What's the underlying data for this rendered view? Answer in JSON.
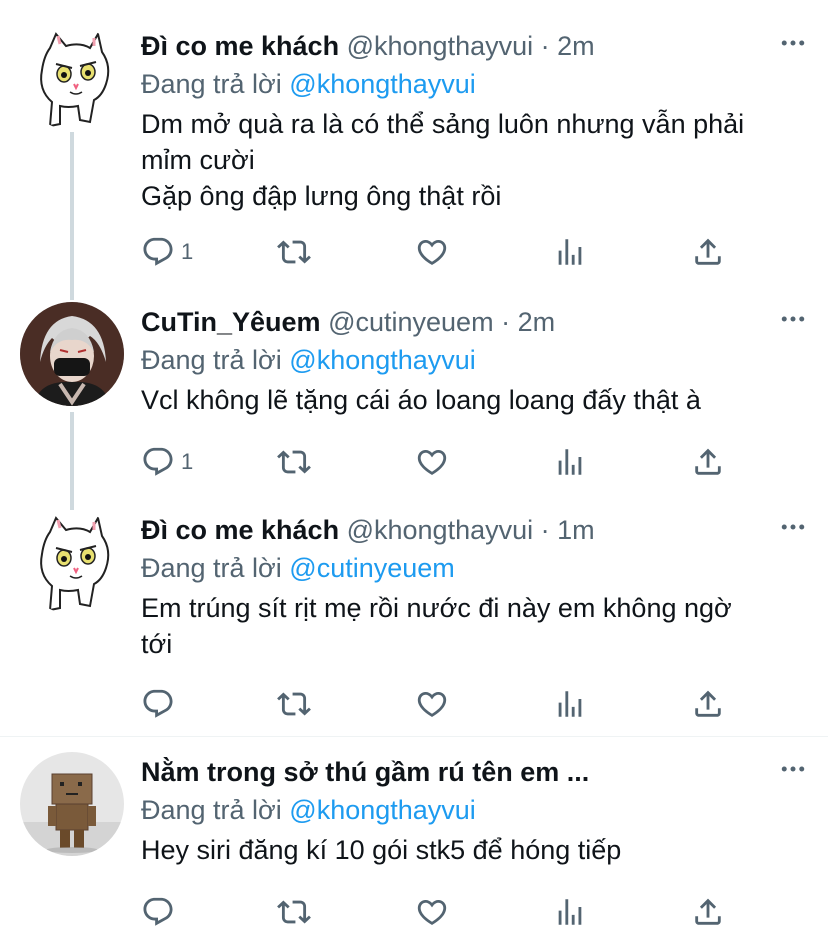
{
  "tweets": [
    {
      "name": "Đì co me khách",
      "handle": "@khongthayvui",
      "sep": "·",
      "time": "2m",
      "reply_prefix": "Đang trả lời",
      "reply_to": "@khongthayvui",
      "text": "Dm mở quà ra là có thể sảng luôn nhưng vẫn phải\nmỉm cười\nGặp ông đập lưng ông thật rồi",
      "reply_count": "1",
      "avatar_icon": "cat-avatar-icon"
    },
    {
      "name": "CuTin_Yêuem",
      "handle": "@cutinyeuem",
      "sep": "·",
      "time": "2m",
      "reply_prefix": "Đang trả lời",
      "reply_to": "@khongthayvui",
      "text": "Vcl không lẽ tặng cái áo loang loang đấy thật à",
      "reply_count": "1",
      "avatar_icon": "anime-avatar-icon"
    },
    {
      "name": "Đì co me khách",
      "handle": "@khongthayvui",
      "sep": "·",
      "time": "1m",
      "reply_prefix": "Đang trả lời",
      "reply_to": "@cutinyeuem",
      "text": "Em trúng sít rịt mẹ rồi nước đi này em không ngờ\ntới",
      "reply_count": "",
      "avatar_icon": "cat-avatar-icon"
    },
    {
      "name": "Nằm trong sở thú gầm rú tên em ...",
      "handle": "",
      "sep": "",
      "time": "",
      "reply_prefix": "Đang trả lời",
      "reply_to": "@khongthayvui",
      "text": "Hey siri đăng kí 10 gói stk5 để hóng tiếp",
      "reply_count": "",
      "avatar_icon": "cardboard-box-avatar-icon"
    }
  ],
  "colors": {
    "link": "#1d9bf0",
    "secondary_text": "#536471",
    "primary_text": "#0f1419",
    "thread_line": "#cfd9de"
  },
  "icons": {
    "reply": "reply-icon",
    "retweet": "retweet-icon",
    "like": "heart-icon",
    "stats": "stats-icon",
    "share": "share-icon",
    "more": "more-icon"
  }
}
